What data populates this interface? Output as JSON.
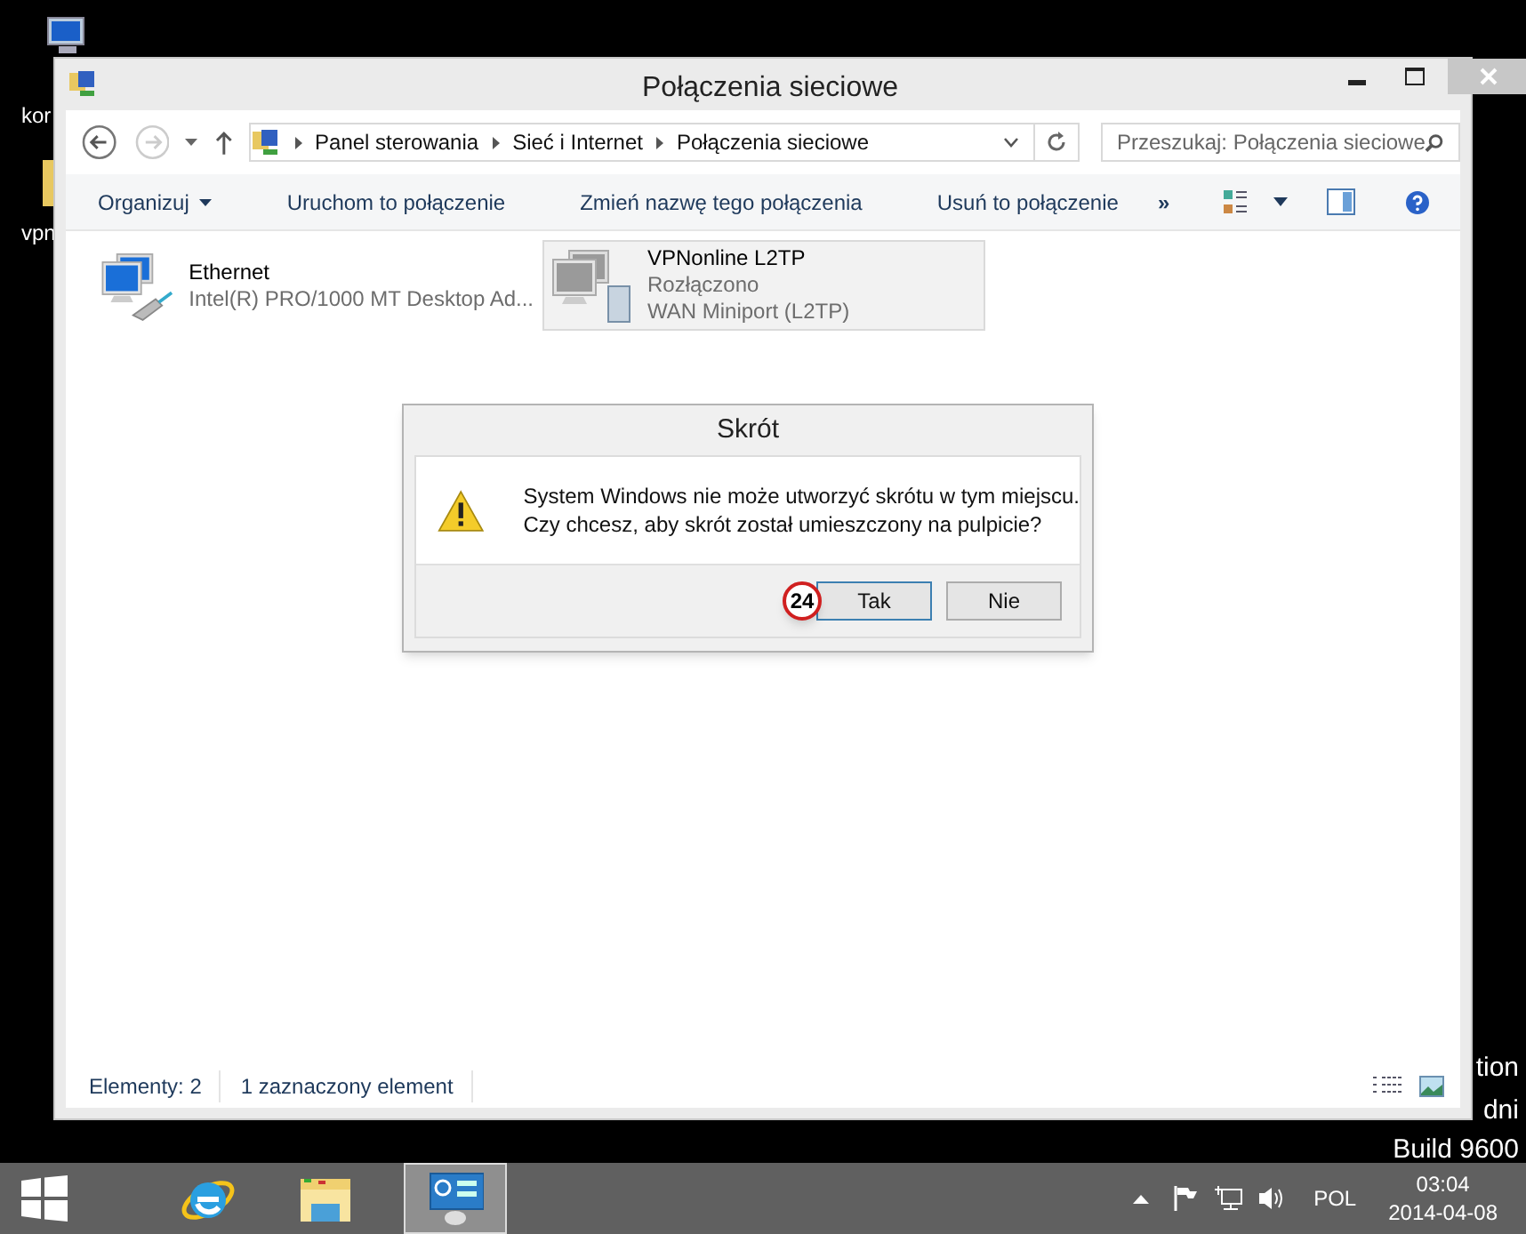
{
  "desktop": {
    "icon_labels": [
      "kor",
      "vpn"
    ],
    "watermark": [
      "tion",
      "dni",
      "Build 9600"
    ]
  },
  "window": {
    "title": "Połączenia sieciowe"
  },
  "address_bar": {
    "breadcrumbs": [
      "Panel sterowania",
      "Sieć i Internet",
      "Połączenia sieciowe"
    ],
    "search_placeholder": "Przeszukaj: Połączenia sieciowe"
  },
  "toolbar": {
    "commands": [
      "Organizuj",
      "Uruchom to połączenie",
      "Zmień nazwę tego połączenia",
      "Usuń to połączenie"
    ],
    "more": "»"
  },
  "connections": [
    {
      "name": "Ethernet",
      "status": "Intel(R) PRO/1000 MT Desktop Ad...",
      "selected": false,
      "kind": "ethernet"
    },
    {
      "name": "VPNonline L2TP",
      "status": "Rozłączono",
      "device": "WAN Miniport (L2TP)",
      "selected": true,
      "kind": "vpn"
    }
  ],
  "status_bar": {
    "items": [
      "Elementy: 2",
      "1 zaznaczony element"
    ]
  },
  "dialog": {
    "title": "Skrót",
    "message": [
      "System Windows nie może utworzyć skrótu w tym miejscu.",
      "Czy chcesz, aby skrót został umieszczony na pulpicie?"
    ],
    "buttons": [
      {
        "label": "Tak",
        "selected": true
      },
      {
        "label": "Nie",
        "selected": false
      }
    ],
    "annotation": "24"
  },
  "taskbar": {
    "apps": [
      {
        "kind": "ie",
        "selected": false
      },
      {
        "kind": "explorer",
        "selected": false
      },
      {
        "kind": "control",
        "selected": true
      }
    ],
    "language": "POL",
    "time": "03:04",
    "date": "2014-04-08"
  }
}
